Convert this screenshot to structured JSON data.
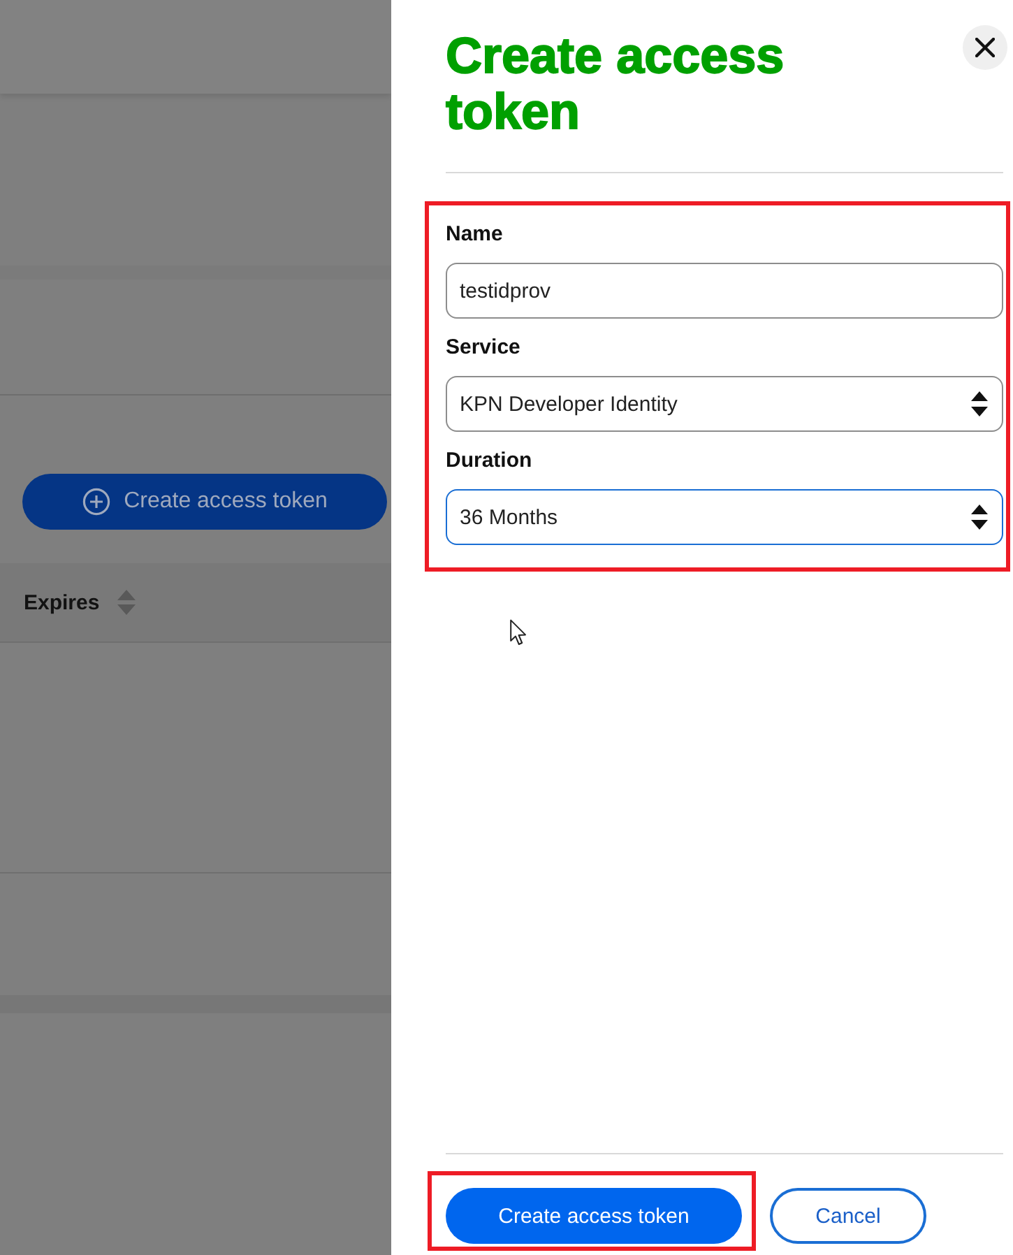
{
  "backdrop": {
    "create_button": {
      "label": "Create access token"
    },
    "table": {
      "columns": [
        {
          "label": "Expires",
          "sortable": true
        }
      ]
    }
  },
  "drawer": {
    "title": "Create access token",
    "form": {
      "highlighted": true,
      "fields": [
        {
          "kind": "text",
          "label": "Name",
          "value": "testidprov",
          "focused": false
        },
        {
          "kind": "select",
          "label": "Service",
          "value": "KPN Developer Identity",
          "focused": false
        },
        {
          "kind": "select",
          "label": "Duration",
          "value": "36 Months",
          "focused": true
        }
      ]
    },
    "buttons": [
      {
        "kind": "primary",
        "label": "Create access token",
        "highlighted": true
      },
      {
        "kind": "secondary",
        "label": "Cancel",
        "highlighted": false
      }
    ]
  }
}
